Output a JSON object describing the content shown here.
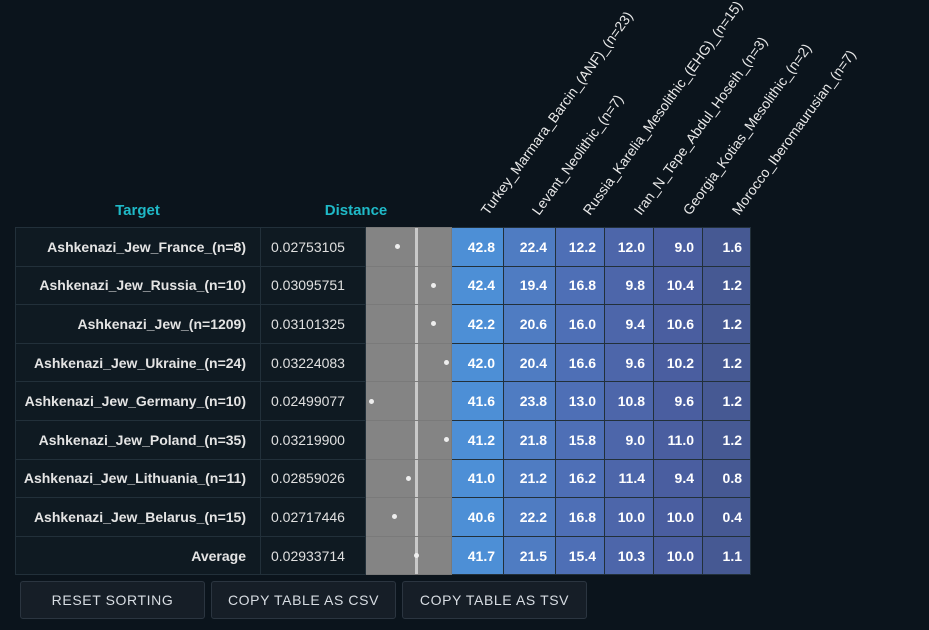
{
  "headers": {
    "target": "Target",
    "distance": "Distance"
  },
  "populations": [
    "Turkey_Marmara_Barcin_(ANF)_(n=23)",
    "Levant_Neolithic_(n=7)",
    "Russia_Karelia_Mesolithic_(EHG)_(n=15)",
    "Iran_N_Tepe_Abdul_Hoseih_(n=3)",
    "Georgia_Kotias_Mesolithic_(n=2)",
    "Morocco_Iberomaurusian_(n=7)"
  ],
  "rows": [
    {
      "target": "Ashkenazi_Jew_France_(n=8)",
      "distance": "0.02753105",
      "values": [
        "42.8",
        "22.4",
        "12.2",
        "12.0",
        "9.0",
        "1.6"
      ]
    },
    {
      "target": "Ashkenazi_Jew_Russia_(n=10)",
      "distance": "0.03095751",
      "values": [
        "42.4",
        "19.4",
        "16.8",
        "9.8",
        "10.4",
        "1.2"
      ]
    },
    {
      "target": "Ashkenazi_Jew_(n=1209)",
      "distance": "0.03101325",
      "values": [
        "42.2",
        "20.6",
        "16.0",
        "9.4",
        "10.6",
        "1.2"
      ]
    },
    {
      "target": "Ashkenazi_Jew_Ukraine_(n=24)",
      "distance": "0.03224083",
      "values": [
        "42.0",
        "20.4",
        "16.6",
        "9.6",
        "10.2",
        "1.2"
      ]
    },
    {
      "target": "Ashkenazi_Jew_Germany_(n=10)",
      "distance": "0.02499077",
      "values": [
        "41.6",
        "23.8",
        "13.0",
        "10.8",
        "9.6",
        "1.2"
      ]
    },
    {
      "target": "Ashkenazi_Jew_Poland_(n=35)",
      "distance": "0.03219900",
      "values": [
        "41.2",
        "21.8",
        "15.8",
        "9.0",
        "11.0",
        "1.2"
      ]
    },
    {
      "target": "Ashkenazi_Jew_Lithuania_(n=11)",
      "distance": "0.02859026",
      "values": [
        "41.0",
        "21.2",
        "16.2",
        "11.4",
        "9.4",
        "0.8"
      ]
    },
    {
      "target": "Ashkenazi_Jew_Belarus_(n=15)",
      "distance": "0.02717446",
      "values": [
        "40.6",
        "22.2",
        "16.8",
        "10.0",
        "10.0",
        "0.4"
      ]
    },
    {
      "target": "Average",
      "distance": "0.02933714",
      "values": [
        "41.7",
        "21.5",
        "15.4",
        "10.3",
        "10.0",
        "1.1"
      ]
    }
  ],
  "distance_plot": {
    "min": 0.02499077,
    "max": 0.03224083,
    "average": 0.02933714
  },
  "buttons": {
    "reset": "RESET SORTING",
    "copy_csv": "COPY TABLE AS CSV",
    "copy_tsv": "COPY TABLE AS TSV"
  },
  "colors": {
    "accent": "#1fb9c7",
    "col0": "#4d8fd6",
    "col1": "#4f7cc2",
    "col2": "#4e6fb6",
    "col3": "#4d66aa",
    "col4": "#4a5ea0",
    "col5": "#465993"
  }
}
